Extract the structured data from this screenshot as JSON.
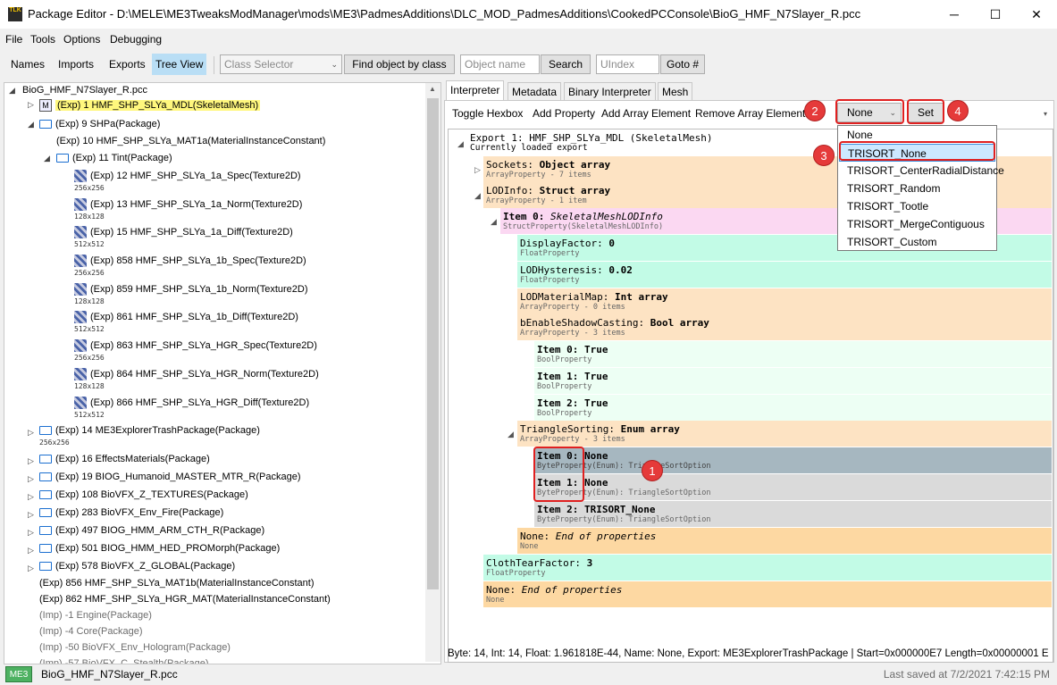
{
  "window": {
    "title": "Package Editor - D:\\MELE\\ME3TweaksModManager\\mods\\ME3\\PadmesAdditions\\DLC_MOD_PadmesAdditions\\CookedPCConsole\\BioG_HMF_N7Slayer_R.pcc",
    "app_icon_text": "TLK",
    "minimize": "─",
    "maximize": "☐",
    "close": "✕"
  },
  "menu": [
    "File",
    "Tools",
    "Options",
    "Debugging"
  ],
  "toolbar": {
    "tabs": [
      "Names",
      "Imports",
      "Exports",
      "Tree View"
    ],
    "active_tab": "Tree View",
    "class_selector_placeholder": "Class Selector",
    "find_by_class": "Find object by class",
    "object_name_placeholder": "Object name",
    "search": "Search",
    "uindex_placeholder": "UIndex",
    "goto": "Goto #"
  },
  "tree": {
    "root": "BioG_HMF_N7Slayer_R.pcc",
    "rows": [
      {
        "label": "(Exp) 1 HMF_SHP_SLYa_MDL(SkeletalMesh)",
        "icon": "M",
        "selected": true
      },
      {
        "label": "(Exp) 9 SHPa(Package)",
        "icon": "folder"
      },
      {
        "label": "(Exp) 10 HMF_SHP_SLYa_MAT1a(MaterialInstanceConstant)"
      },
      {
        "label": "(Exp) 11 Tint(Package)",
        "icon": "folder"
      },
      {
        "label": "(Exp) 12 HMF_SHP_SLYa_1a_Spec(Texture2D)",
        "sub": "256x256"
      },
      {
        "label": "(Exp) 13 HMF_SHP_SLYa_1a_Norm(Texture2D)",
        "sub": "128x128"
      },
      {
        "label": "(Exp) 15 HMF_SHP_SLYa_1a_Diff(Texture2D)",
        "sub": "512x512"
      },
      {
        "label": "(Exp) 858 HMF_SHP_SLYa_1b_Spec(Texture2D)",
        "sub": "256x256"
      },
      {
        "label": "(Exp) 859 HMF_SHP_SLYa_1b_Norm(Texture2D)",
        "sub": "128x128"
      },
      {
        "label": "(Exp) 861 HMF_SHP_SLYa_1b_Diff(Texture2D)",
        "sub": "512x512"
      },
      {
        "label": "(Exp) 863 HMF_SHP_SLYa_HGR_Spec(Texture2D)",
        "sub": "256x256"
      },
      {
        "label": "(Exp) 864 HMF_SHP_SLYa_HGR_Norm(Texture2D)",
        "sub": "128x128"
      },
      {
        "label": "(Exp) 866 HMF_SHP_SLYa_HGR_Diff(Texture2D)",
        "sub": "512x512"
      },
      {
        "label": "(Exp) 14 ME3ExplorerTrashPackage(Package)",
        "sub": "256x256"
      },
      {
        "label": "(Exp) 16 EffectsMaterials(Package)"
      },
      {
        "label": "(Exp) 19 BIOG_Humanoid_MASTER_MTR_R(Package)"
      },
      {
        "label": "(Exp) 108 BioVFX_Z_TEXTURES(Package)"
      },
      {
        "label": "(Exp) 283 BioVFX_Env_Fire(Package)"
      },
      {
        "label": "(Exp) 497 BIOG_HMM_ARM_CTH_R(Package)"
      },
      {
        "label": "(Exp) 501 BIOG_HMM_HED_PROMorph(Package)"
      },
      {
        "label": "(Exp) 578 BioVFX_Z_GLOBAL(Package)"
      },
      {
        "label": "(Exp) 856 HMF_SHP_SLYa_MAT1b(MaterialInstanceConstant)"
      },
      {
        "label": "(Exp) 862 HMF_SHP_SLYa_HGR_MAT(MaterialInstanceConstant)"
      },
      {
        "label": "(Imp) -1 Engine(Package)"
      },
      {
        "label": "(Imp) -4 Core(Package)"
      },
      {
        "label": "(Imp) -50 BioVFX_Env_Hologram(Package)"
      },
      {
        "label": "(Imp) -57 BioVFX_C_Stealth(Package)"
      }
    ]
  },
  "right": {
    "tabs": [
      "Interpreter",
      "Metadata",
      "Binary Interpreter",
      "Mesh"
    ],
    "active_tab": "Interpreter",
    "actions": [
      "Toggle Hexbox",
      "Add Property",
      "Add Array Element",
      "Remove Array Element"
    ],
    "enum_value": "None",
    "set_button": "Set",
    "dropdown_options": [
      "None",
      "TRISORT_None",
      "TRISORT_CenterRadialDistance",
      "TRISORT_Random",
      "TRISORT_Tootle",
      "TRISORT_MergeContiguous",
      "TRISORT_Custom"
    ],
    "dropdown_highlight": "TRISORT_None",
    "export_header": "Export 1: HMF_SHP_SLYa_MDL (SkeletalMesh)",
    "export_sub": "Currently loaded export",
    "props": [
      {
        "name": "Sockets:",
        "value": "Object array",
        "sub": "ArrayProperty - 7 items"
      },
      {
        "name": "LODInfo:",
        "value": "Struct array",
        "sub": "ArrayProperty - 1 item"
      },
      {
        "name": "Item 0:",
        "value": "SkeletalMeshLODInfo",
        "sub": "StructProperty(SkeletalMeshLODInfo)"
      },
      {
        "name": "DisplayFactor:",
        "value": "0",
        "sub": "FloatProperty"
      },
      {
        "name": "LODHysteresis:",
        "value": "0.02",
        "sub": "FloatProperty"
      },
      {
        "name": "LODMaterialMap:",
        "value": "Int array",
        "sub": "ArrayProperty - 0 items"
      },
      {
        "name": "bEnableShadowCasting:",
        "value": "Bool array",
        "sub": "ArrayProperty - 3 items"
      },
      {
        "name": "Item 0:",
        "value": "True",
        "sub": "BoolProperty"
      },
      {
        "name": "Item 1:",
        "value": "True",
        "sub": "BoolProperty"
      },
      {
        "name": "Item 2:",
        "value": "True",
        "sub": "BoolProperty"
      },
      {
        "name": "TriangleSorting:",
        "value": "Enum array",
        "sub": "ArrayProperty - 3 items"
      },
      {
        "name": "Item 0:",
        "value": "None",
        "sub": "ByteProperty(Enum): TriangleSortOption"
      },
      {
        "name": "Item 1:",
        "value": "None",
        "sub": "ByteProperty(Enum): TriangleSortOption"
      },
      {
        "name": "Item 2:",
        "value": "TRISORT_None",
        "sub": "ByteProperty(Enum): TriangleSortOption"
      },
      {
        "name": "None:",
        "value": "End of properties",
        "sub": "None"
      },
      {
        "name": "ClothTearFactor:",
        "value": "3",
        "sub": "FloatProperty"
      },
      {
        "name": "None:",
        "value": "End of properties",
        "sub": "None"
      }
    ],
    "status_line": "Byte: 14, Int: 14, Float: 1.961818E-44, Name: None, Export: ME3ExplorerTrashPackage | Start=0x000000E7 Length=0x00000001 E"
  },
  "annotations": [
    "1",
    "2",
    "3",
    "4"
  ],
  "statusbar": {
    "game": "ME3",
    "file": "BioG_HMF_N7Slayer_R.pcc",
    "last_saved": "Last saved at 7/2/2021 7:42:15 PM"
  },
  "colors": {
    "selected_highlight": "#fff77d",
    "annotation_red": "#e53a3a",
    "active_tab_blue": "#b9def5"
  }
}
